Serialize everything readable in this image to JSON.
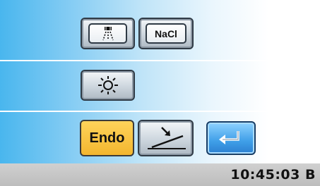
{
  "buttons": {
    "spray_icon": "spray-icon",
    "nacl_label": "NaCl",
    "light_icon": "light-icon",
    "endo_label": "Endo",
    "tilt_icon": "tilt-icon",
    "back_icon": "return-arrow-icon"
  },
  "status_bar": {
    "time": "10:45:03",
    "trailing": "B"
  },
  "colors": {
    "accent_blue": "#49b6ee",
    "endo_yellow": "#f3b62f",
    "back_blue": "#3f9fe8",
    "status_gray": "#c4c4c4"
  }
}
